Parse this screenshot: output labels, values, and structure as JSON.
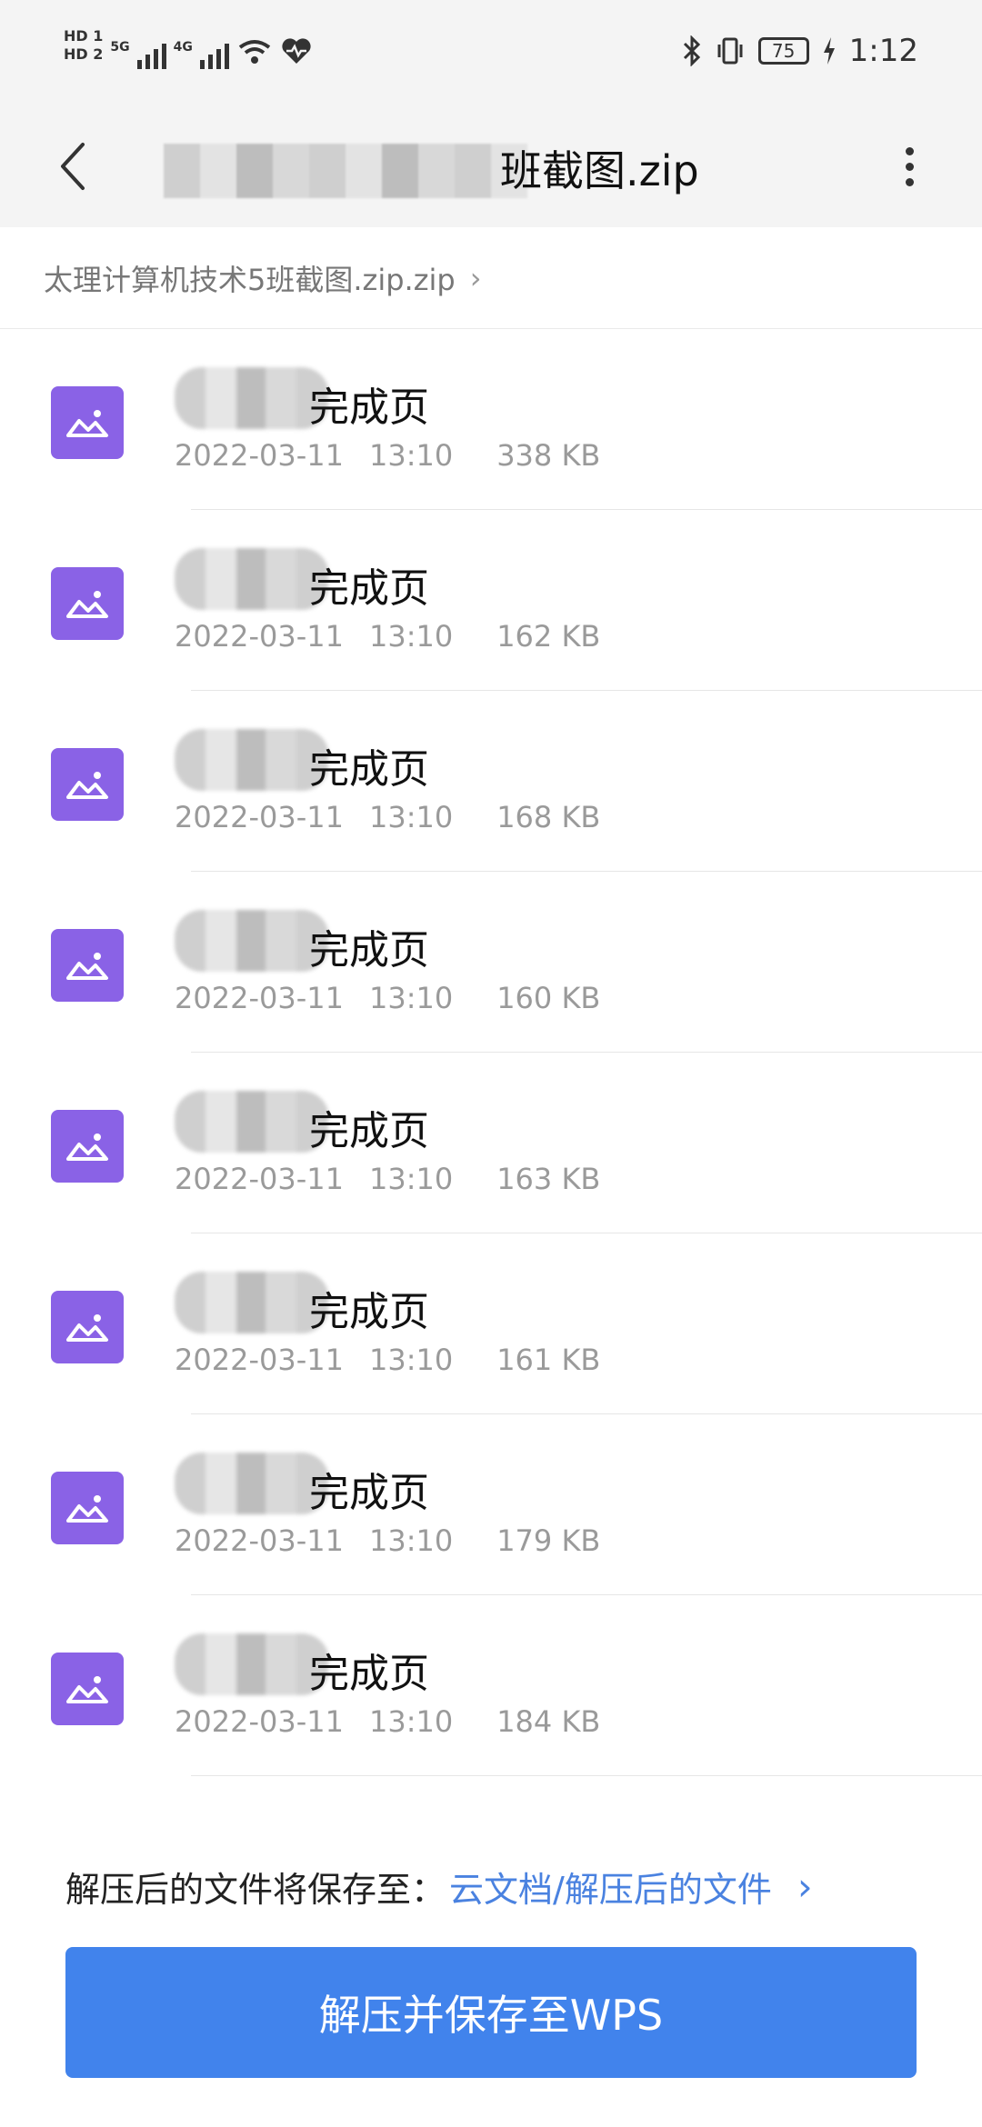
{
  "status_bar": {
    "hd1": "HD 1",
    "hd2": "HD 2",
    "net1": "5G",
    "net2": "4G",
    "battery": "75",
    "time": "1:12"
  },
  "app_bar": {
    "title": "班截图.zip"
  },
  "breadcrumb": {
    "label": "太理计算机技术5班截图.zip.zip"
  },
  "files": [
    {
      "name": "完成页",
      "date": "2022-03-11",
      "time": "13:10",
      "size": "338 KB"
    },
    {
      "name": "完成页",
      "date": "2022-03-11",
      "time": "13:10",
      "size": "162 KB"
    },
    {
      "name": "完成页",
      "date": "2022-03-11",
      "time": "13:10",
      "size": "168 KB"
    },
    {
      "name": "完成页",
      "date": "2022-03-11",
      "time": "13:10",
      "size": "160 KB"
    },
    {
      "name": "完成页",
      "date": "2022-03-11",
      "time": "13:10",
      "size": "163 KB"
    },
    {
      "name": "完成页",
      "date": "2022-03-11",
      "time": "13:10",
      "size": "161 KB"
    },
    {
      "name": "完成页",
      "date": "2022-03-11",
      "time": "13:10",
      "size": "179 KB"
    },
    {
      "name": "完成页",
      "date": "2022-03-11",
      "time": "13:10",
      "size": "184 KB"
    }
  ],
  "footer": {
    "save_prefix": "解压后的文件将保存至：",
    "save_path": "云文档/解压后的文件",
    "button": "解压并保存至WPS"
  },
  "colors": {
    "accent": "#4183ec",
    "icon_purple": "#8a62e6",
    "link": "#4a82e0"
  }
}
